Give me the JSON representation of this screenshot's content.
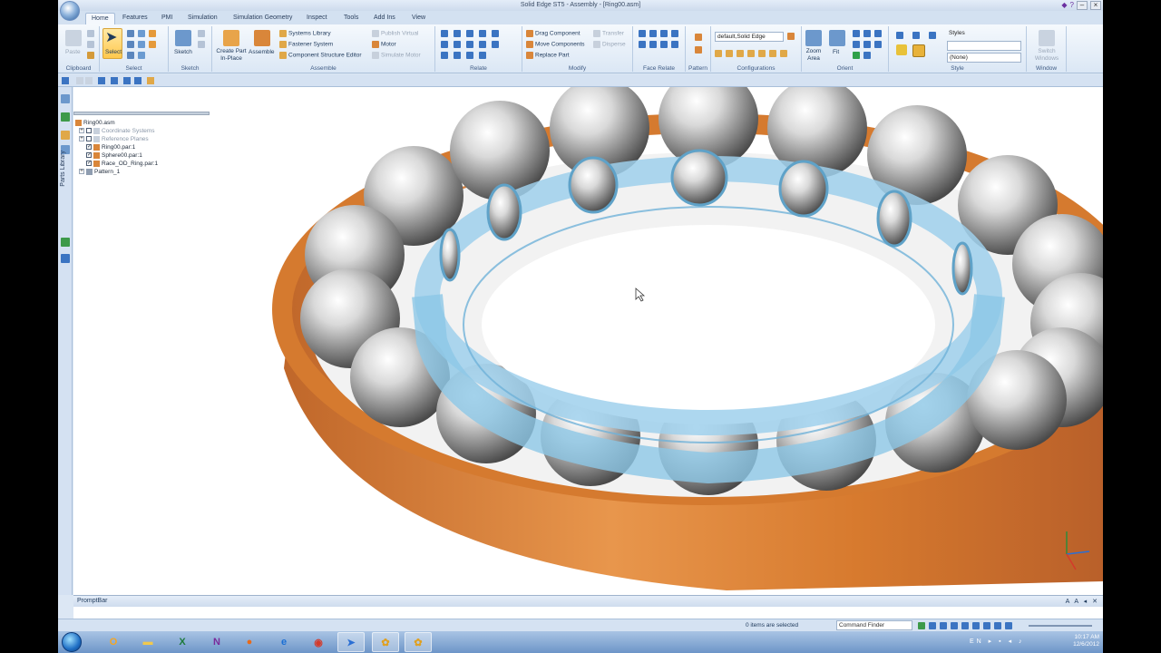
{
  "window": {
    "title": "Solid Edge ST5 - Assembly - [Ring00.asm]",
    "title_icons": [
      "help-icon",
      "minimize-icon",
      "restore-icon",
      "close-icon"
    ]
  },
  "tabs": [
    "Home",
    "Features",
    "PMI",
    "Simulation",
    "Simulation Geometry",
    "Inspect",
    "Tools",
    "Add Ins",
    "View"
  ],
  "active_tab": "Home",
  "ribbon": {
    "clipboard": {
      "label": "Clipboard",
      "paste": "Paste"
    },
    "select": {
      "label": "Select",
      "select": "Select"
    },
    "sketch": {
      "label": "Sketch",
      "sketch": "Sketch"
    },
    "assemble": {
      "label": "Assemble",
      "create_part": "Create Part In-Place",
      "assemble": "Assemble",
      "systems_library": "Systems Library",
      "fastener_system": "Fastener System",
      "component_structure_editor": "Component Structure Editor",
      "publish_virtual": "Publish Virtual",
      "motor": "Motor",
      "simulate_motor": "Simulate Motor"
    },
    "relate": {
      "label": "Relate"
    },
    "modify": {
      "label": "Modify",
      "drag_component": "Drag Component",
      "move_components": "Move Components",
      "replace_part": "Replace Part",
      "transfer": "Transfer",
      "disperse": "Disperse"
    },
    "face_relate": {
      "label": "Face Relate"
    },
    "pattern": {
      "label": "Pattern"
    },
    "configurations": {
      "label": "Configurations",
      "value": "default,Solid Edge"
    },
    "orient": {
      "label": "Orient",
      "zoom_area": "Zoom Area",
      "fit": "Fit"
    },
    "style": {
      "label": "Style",
      "styles": "Styles",
      "none": "(None)"
    },
    "window": {
      "label": "Window",
      "switch_windows": "Switch Windows"
    }
  },
  "side_bar": {
    "parts_library": "Parts Library"
  },
  "tree": [
    {
      "label": "Ring00.asm",
      "icon": "assembly-icon",
      "checked": null,
      "dim": false
    },
    {
      "label": "Coordinate Systems",
      "icon": "coordinate-icon",
      "checked": false,
      "dim": true
    },
    {
      "label": "Reference Planes",
      "icon": "plane-icon",
      "checked": false,
      "dim": true
    },
    {
      "label": "Ring00.par:1",
      "icon": "part-icon",
      "checked": true,
      "dim": false
    },
    {
      "label": "Sphere00.par:1",
      "icon": "part-icon",
      "checked": true,
      "dim": false
    },
    {
      "label": "Race_OD_Ring.par:1",
      "icon": "part-icon",
      "checked": true,
      "dim": false
    },
    {
      "label": "Pattern_1",
      "icon": "pattern-icon",
      "checked": null,
      "dim": false
    }
  ],
  "prompt_bar": {
    "label": "PromptBar",
    "tools": "A A"
  },
  "status": {
    "message": "0 items are selected",
    "command_finder": "Command Finder"
  },
  "taskbar": {
    "apps": [
      "outlook-icon",
      "explorer-icon",
      "excel-icon",
      "onenote-icon",
      "firefox-icon",
      "ie-icon",
      "chrome-icon",
      "solid-edge-icon",
      "flower-app-icon",
      "flower-app-icon"
    ],
    "language": "EN",
    "time": "10:17 AM",
    "date": "12/6/2012"
  },
  "colors": {
    "outer_ring": "#d77a2e",
    "cage": "#8cc7e6",
    "ribbon": "#dbe7f5",
    "accent_select": "#ffc94d"
  }
}
